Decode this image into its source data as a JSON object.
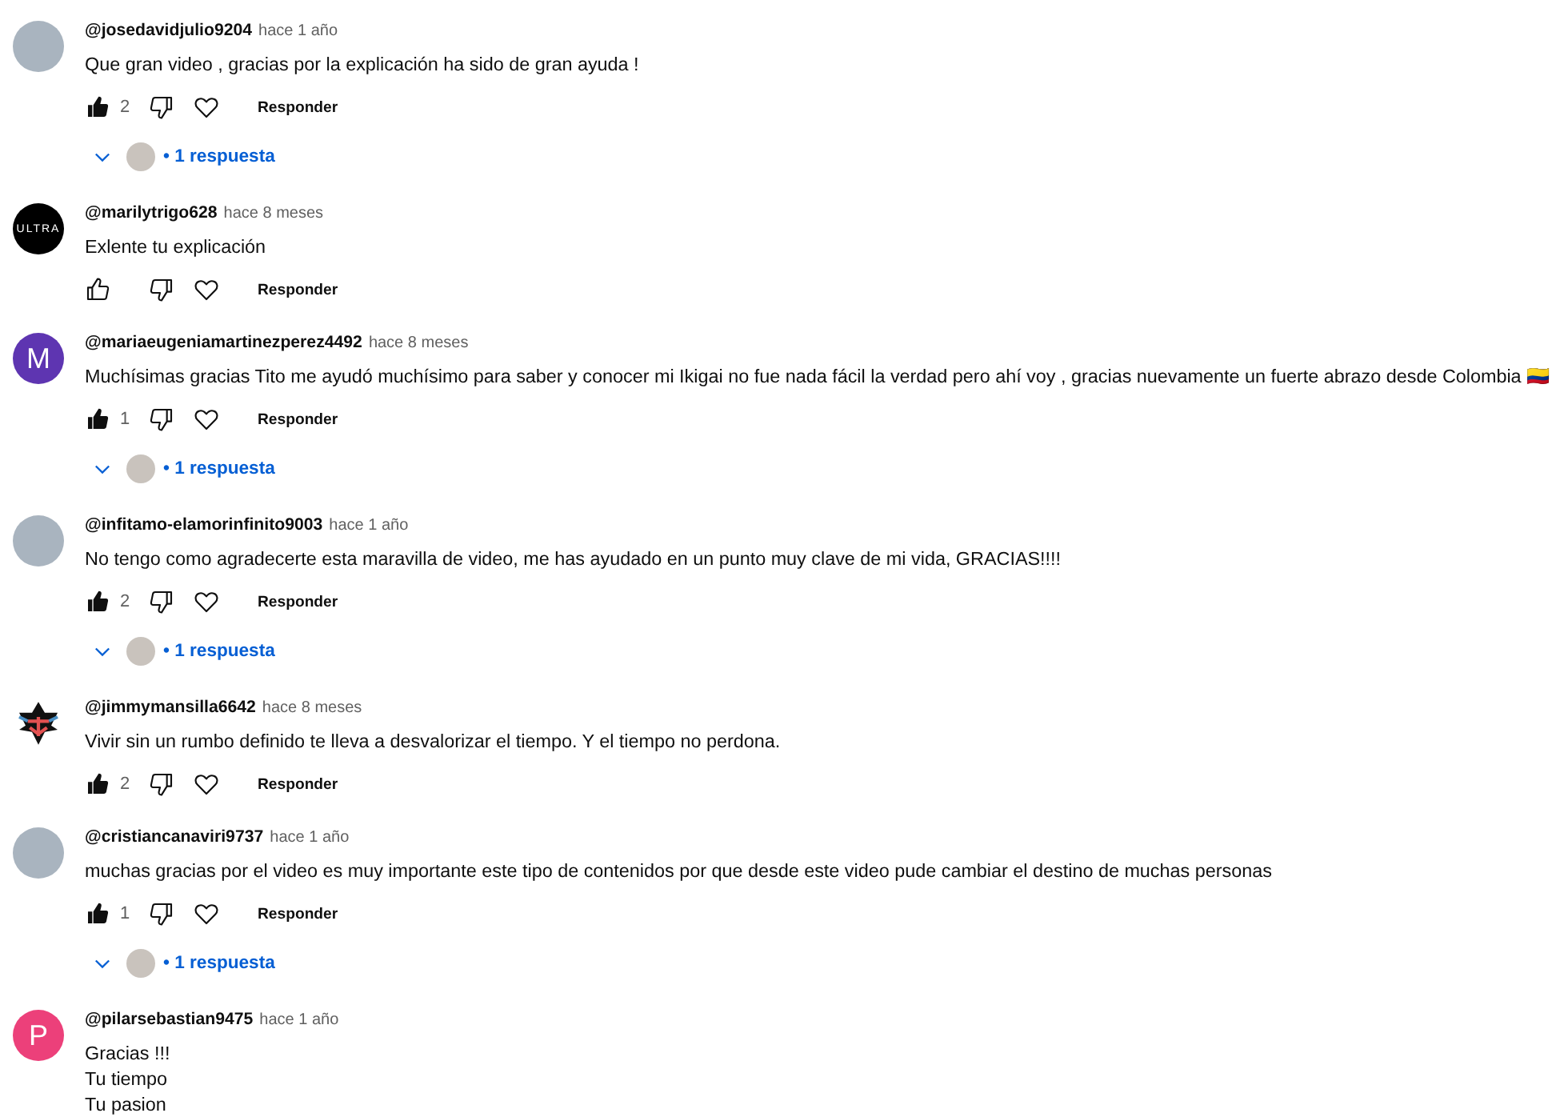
{
  "comments": [
    {
      "avatar": {
        "kind": "photo"
      },
      "username": "@josedavidjulio9204",
      "time": "hace 1 año",
      "text": "Que gran video , gracias por la explicación ha sido de gran ayuda !",
      "liked": true,
      "likes": "2",
      "reply_label": "Responder",
      "replies": {
        "count": "• 1 respuesta"
      }
    },
    {
      "avatar": {
        "kind": "logo",
        "text": "ULTRA"
      },
      "username": "@marilytrigo628",
      "time": "hace 8 meses",
      "text": "Exlente tu explicación",
      "liked": false,
      "reply_label": "Responder"
    },
    {
      "avatar": {
        "kind": "letter",
        "letter": "M",
        "color": "#5e35b1"
      },
      "username": "@mariaeugeniamartinezperez4492",
      "time": "hace 8 meses",
      "text": "Muchísimas gracias Tito me ayudó muchísimo para saber y conocer mi Ikigai no fue nada fácil la verdad pero ahí voy , gracias nuevamente un fuerte abrazo desde Colombia 🇨🇴",
      "liked": true,
      "likes": "1",
      "reply_label": "Responder",
      "replies": {
        "count": "• 1 respuesta"
      }
    },
    {
      "avatar": {
        "kind": "photo"
      },
      "username": "@infitamo-elamorinfinito9003",
      "time": "hace 1 año",
      "text": "No tengo como agradecerte esta maravilla de video, me has ayudado en un punto muy clave de mi vida, GRACIAS!!!!",
      "liked": true,
      "likes": "2",
      "reply_label": "Responder",
      "replies": {
        "count": "• 1 respuesta"
      }
    },
    {
      "avatar": {
        "kind": "art"
      },
      "username": "@jimmymansilla6642",
      "time": "hace 8 meses",
      "text": "Vivir sin un rumbo definido te lleva a desvalorizar el tiempo. Y el tiempo no perdona.",
      "liked": true,
      "likes": "2",
      "reply_label": "Responder"
    },
    {
      "avatar": {
        "kind": "photo"
      },
      "username": "@cristiancanaviri9737",
      "time": "hace 1 año",
      "text": "muchas gracias por el video es muy importante este tipo de contenidos por que desde este video pude cambiar el destino de muchas personas",
      "liked": true,
      "likes": "1",
      "reply_label": "Responder",
      "replies": {
        "count": "• 1 respuesta"
      }
    },
    {
      "avatar": {
        "kind": "letter",
        "letter": "P",
        "color": "#ec407a"
      },
      "username": "@pilarsebastian9475",
      "time": "hace 1 año",
      "text": "Gracias !!!\nTu tiempo\nTu pasion"
    }
  ]
}
